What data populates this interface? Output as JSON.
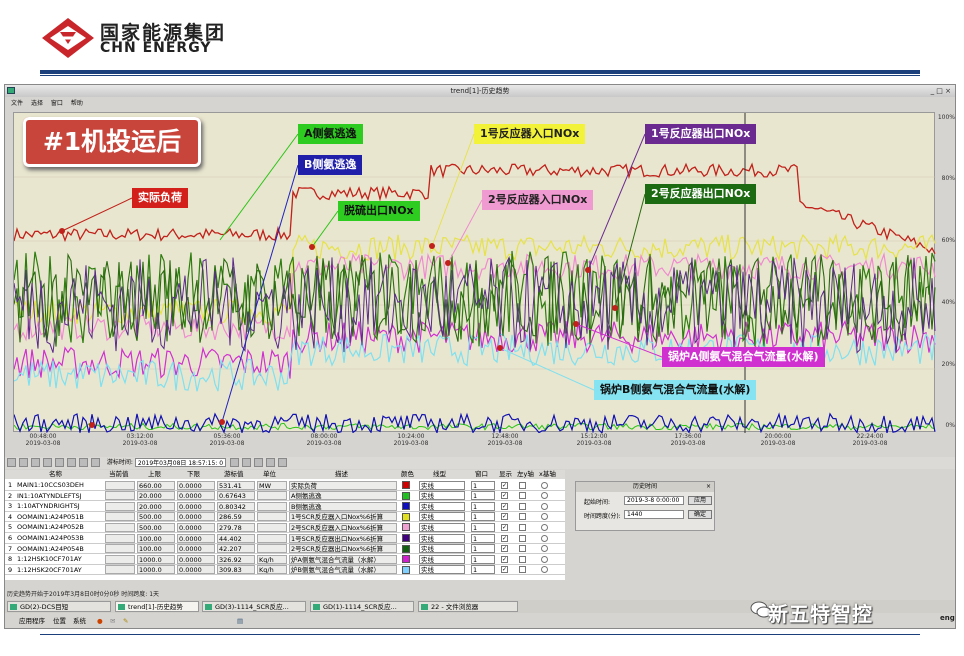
{
  "logo": {
    "cn": "国家能源集团",
    "en": "CHN ENERGY"
  },
  "window": {
    "title": "trend[1]-历史趋势",
    "menu": [
      "文件",
      "选择",
      "窗口",
      "帮助"
    ]
  },
  "banner": "#1机投运后",
  "annotations": {
    "actual_load": "实际负荷",
    "a_ammonia_slip": "A侧氨逃逸",
    "b_ammonia_slip": "B侧氨逃逸",
    "desulf_outlet_nox": "脱硫出口NOx",
    "r1_inlet_nox": "1号反应器入口NOx",
    "r1_outlet_nox": "1号反应器出口NOx",
    "r2_inlet_nox": "2号反应器入口NOx",
    "r2_outlet_nox": "2号反应器出口NOx",
    "boiler_a_flow": "锅炉A侧氨气混合气流量(水解)",
    "boiler_b_flow": "锅炉B侧氨气混合气流量(水解)"
  },
  "colors": {
    "load": "#c0211a",
    "a_slip": "#28c414",
    "b_slip": "#1010b0",
    "desulf": "#2e7d0f",
    "r1_in": "#e6e24a",
    "r1_out": "#5a2a8a",
    "r2_in": "#f08ad0",
    "r2_out": "#2a6a10",
    "boiler_a": "#d030d0",
    "boiler_b": "#7fe0f0",
    "plot_bg": "#e9e6cf"
  },
  "right_axis": [
    "100%",
    "80%",
    "60%",
    "40%",
    "20%",
    "0%"
  ],
  "x_axis": [
    {
      "time": "00:48:00",
      "date": "2019-03-08"
    },
    {
      "time": "03:12:00",
      "date": "2019-03-08"
    },
    {
      "time": "05:36:00",
      "date": "2019-03-08"
    },
    {
      "time": "08:00:00",
      "date": "2019-03-08"
    },
    {
      "time": "10:24:00",
      "date": "2019-03-08"
    },
    {
      "time": "12:48:00",
      "date": "2019-03-08"
    },
    {
      "time": "15:12:00",
      "date": "2019-03-08"
    },
    {
      "time": "17:36:00",
      "date": "2019-03-08"
    },
    {
      "time": "20:00:00",
      "date": "2019-03-08"
    },
    {
      "time": "22:24:00",
      "date": "2019-03-08"
    }
  ],
  "toolbar": {
    "cursor_label": "游标时间:",
    "cursor_time": "2019年03月08日 18:57:15: 0"
  },
  "table": {
    "headers": [
      "名称",
      "当前值",
      "上限",
      "下限",
      "游标值",
      "单位",
      "描述",
      "颜色",
      "线型",
      "窗口",
      "显示",
      "左y轴",
      "x基轴"
    ],
    "rows": [
      {
        "n": "1",
        "name": "MAIN1:10CCS03DEH",
        "upper": "660.00",
        "lower": "0.0000",
        "cursor": "531.41",
        "unit": "MW",
        "desc": "实际负荷",
        "color": "#d00000",
        "line": "实线",
        "win": "1"
      },
      {
        "n": "2",
        "name": "IN1:10ATYNDLEFTSJ",
        "upper": "20.000",
        "lower": "0.0000",
        "cursor": "0.67643",
        "unit": "",
        "desc": "A侧氨逃逸",
        "color": "#20c020",
        "line": "实线",
        "win": "1"
      },
      {
        "n": "3",
        "name": "1:10ATYNDRIGHTSJ",
        "upper": "20.000",
        "lower": "0.0000",
        "cursor": "0.80342",
        "unit": "",
        "desc": "B侧氨逃逸",
        "color": "#1010c0",
        "line": "实线",
        "win": "1"
      },
      {
        "n": "4",
        "name": "OOMAIN1:A24P051B",
        "upper": "500.00",
        "lower": "0.0000",
        "cursor": "286.59",
        "unit": "",
        "desc": "1号SCR反应器入口Nox%6折算",
        "color": "#e0e020",
        "line": "实线",
        "win": "1"
      },
      {
        "n": "5",
        "name": "OOMAIN1:A24P052B",
        "upper": "500.00",
        "lower": "0.0000",
        "cursor": "279.78",
        "unit": "",
        "desc": "2号SCR反应器入口Nox%6折算",
        "color": "#f0a0d0",
        "line": "实线",
        "win": "1"
      },
      {
        "n": "6",
        "name": "OOMAIN1:A24P053B",
        "upper": "100.00",
        "lower": "0.0000",
        "cursor": "44.402",
        "unit": "",
        "desc": "1号SCR反应器出口Nox%6折算",
        "color": "#400080",
        "line": "实线",
        "win": "1"
      },
      {
        "n": "7",
        "name": "OOMAIN1:A24P054B",
        "upper": "100.00",
        "lower": "0.0000",
        "cursor": "42.207",
        "unit": "",
        "desc": "2号SCR反应器出口Nox%6折算",
        "color": "#106010",
        "line": "实线",
        "win": "1"
      },
      {
        "n": "8",
        "name": "1:12HSK10CF701AY",
        "upper": "1000.0",
        "lower": "0.0000",
        "cursor": "326.92",
        "unit": "Kg/h",
        "desc": "炉A侧氨气混合气流量（水解）",
        "color": "#d020d0",
        "line": "实线",
        "win": "1"
      },
      {
        "n": "9",
        "name": "1:12HSK20CF701AY",
        "upper": "1000.0",
        "lower": "0.0000",
        "cursor": "309.83",
        "unit": "Kg/h",
        "desc": "炉B侧氨气混合气流量（水解）",
        "color": "#80d0ff",
        "line": "实线",
        "win": "1"
      }
    ]
  },
  "history": {
    "title": "历史时间",
    "start_label": "起始时间:",
    "start_value": "2019-3-8 0:00:00",
    "span_label": "时间跨度(分):",
    "span_value": "1440",
    "apply": "应用",
    "ok": "确定"
  },
  "status": "历史趋势开始于2019年3月8日0时0分0秒  时间跨度: 1天",
  "taskbar": [
    {
      "label": "GD(2)-DCS目短"
    },
    {
      "label": "trend[1]-历史趋势"
    },
    {
      "label": "GD(3)-1114_SCR反应..."
    },
    {
      "label": "GD(1)-1114_SCR反应..."
    },
    {
      "label": "22 - 文件浏览器"
    }
  ],
  "systray": {
    "apps": "应用程序",
    "places": "位置",
    "system": "系统",
    "eng": "eng"
  },
  "watermark": "新五特智控"
}
